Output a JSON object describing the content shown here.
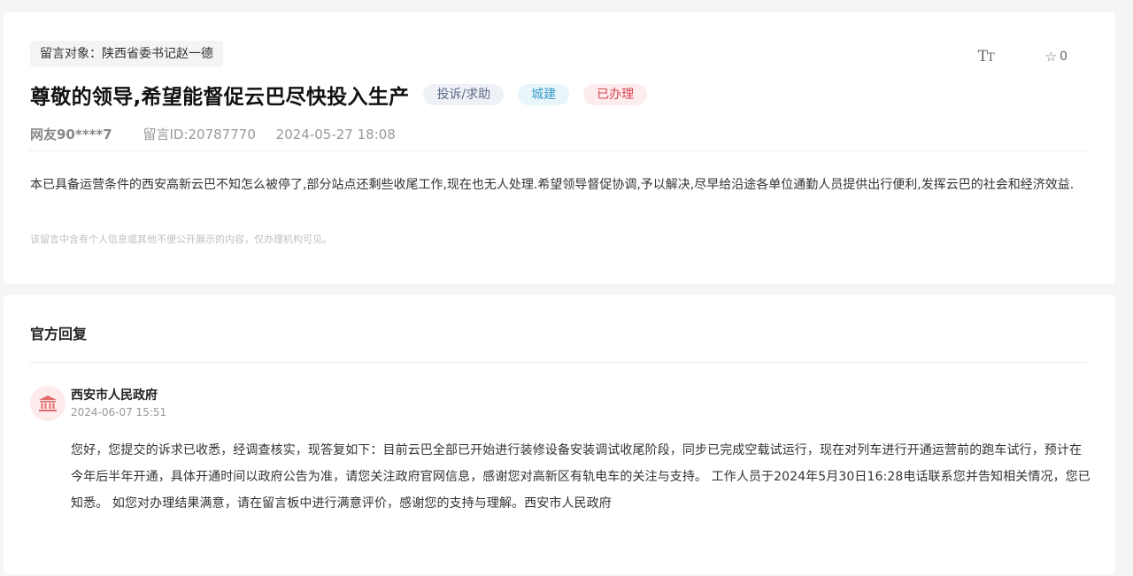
{
  "message": {
    "target": "留言对象：陕西省委书记赵一德",
    "title": "尊敬的领导,希望能督促云巴尽快投入生产",
    "tags": [
      "投诉/求助",
      "城建",
      "已办理"
    ],
    "user": "网友90****7",
    "message_id": "留言ID:20787770",
    "date": "2024-05-27 18:08",
    "content": "本已具备运营条件的西安高新云巴不知怎么被停了,部分站点还剩些收尾工作,现在也无人处理.希望领导督促协调,予以解决,尽早给沿途各单位通勤人员提供出行便利,发挥云巴的社会和经济效益.",
    "privacy_hint": "该留言中含有个人信息或其他不便公开展示的内容，仅办理机构可见。"
  },
  "actions": {
    "font_size_icon": "font-size-icon",
    "favorite_icon": "star-outline-icon",
    "favorite_count": "0"
  },
  "reply": {
    "section_title": "官方回复",
    "org_icon": "government-building-icon",
    "org_name": "西安市人民政府",
    "date": "2024-06-07 15:51",
    "content": "您好，您提交的诉求已收悉，经调查核实，现答复如下：目前云巴全部已开始进行装修设备安装调试收尾阶段，同步已完成空载试运行，现在对列车进行开通运营前的跑车试行，预计在今年后半年开通，具体开通时间以政府公告为准，请您关注政府官网信息，感谢您对高新区有轨电车的关注与支持。 工作人员于2024年5月30日16:28电话联系您并告知相关情况，您已知悉。 如您对办理结果满意，请在留言板中进行满意评价，感谢您的支持与理解。西安市人民政府"
  },
  "colors": {
    "page_bg": "#f4f5f7",
    "tag_complaint": "#5c6b86",
    "tag_construction": "#3a9cc8",
    "tag_done": "#d9434f",
    "avatar_icon": "#e26a6a"
  }
}
